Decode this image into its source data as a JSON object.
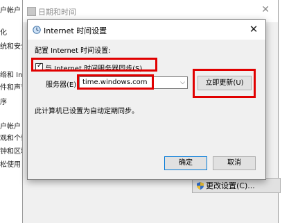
{
  "background": {
    "sidebar_items": [
      "户帐户",
      "化",
      "统和安全",
      "络和 Inte",
      "件和声音",
      "序",
      "户帐户",
      "观和个性",
      "钟和区域",
      "松使用"
    ],
    "window_title": "日期和时间",
    "change_settings_label": "更改设置(C)..."
  },
  "dialog": {
    "title": "Internet 时间设置",
    "section_label": "配置 Internet 时间设置:",
    "checkbox": {
      "label": "与 Internet 时间服务器同步(S)",
      "checked": true
    },
    "server_label": "服务器(E):",
    "server_value": "time.windows.com",
    "update_now_label": "立即更新(U)",
    "status_text": "此计算机已设置为自动定期同步。",
    "ok_label": "确定",
    "cancel_label": "取消",
    "close_glyph": "✕"
  },
  "colors": {
    "highlight": "#e10000",
    "default_button_border": "#0078d7"
  }
}
